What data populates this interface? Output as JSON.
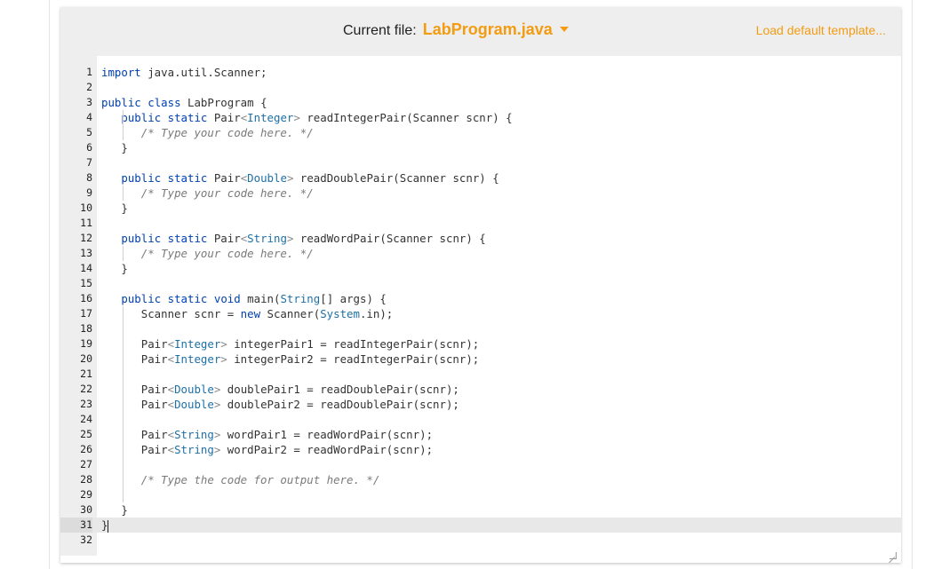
{
  "header": {
    "current_file_label": "Current file:",
    "current_file_name": "LabProgram.java",
    "load_default_label": "Load default template...",
    "accent_color": "#f39c12"
  },
  "editor": {
    "lines": [
      {
        "n": "1",
        "text": "import java.util.Scanner;"
      },
      {
        "n": "2",
        "text": ""
      },
      {
        "n": "3",
        "text": "public class LabProgram {"
      },
      {
        "n": "4",
        "text": "   public static Pair<Integer> readIntegerPair(Scanner scnr) {"
      },
      {
        "n": "5",
        "text": "      /* Type your code here. */"
      },
      {
        "n": "6",
        "text": "   }"
      },
      {
        "n": "7",
        "text": ""
      },
      {
        "n": "8",
        "text": "   public static Pair<Double> readDoublePair(Scanner scnr) {"
      },
      {
        "n": "9",
        "text": "      /* Type your code here. */"
      },
      {
        "n": "10",
        "text": "   }"
      },
      {
        "n": "11",
        "text": ""
      },
      {
        "n": "12",
        "text": "   public static Pair<String> readWordPair(Scanner scnr) {"
      },
      {
        "n": "13",
        "text": "      /* Type your code here. */"
      },
      {
        "n": "14",
        "text": "   }"
      },
      {
        "n": "15",
        "text": ""
      },
      {
        "n": "16",
        "text": "   public static void main(String[] args) {"
      },
      {
        "n": "17",
        "text": "      Scanner scnr = new Scanner(System.in);"
      },
      {
        "n": "18",
        "text": ""
      },
      {
        "n": "19",
        "text": "      Pair<Integer> integerPair1 = readIntegerPair(scnr);"
      },
      {
        "n": "20",
        "text": "      Pair<Integer> integerPair2 = readIntegerPair(scnr);"
      },
      {
        "n": "21",
        "text": ""
      },
      {
        "n": "22",
        "text": "      Pair<Double> doublePair1 = readDoublePair(scnr);"
      },
      {
        "n": "23",
        "text": "      Pair<Double> doublePair2 = readDoublePair(scnr);"
      },
      {
        "n": "24",
        "text": ""
      },
      {
        "n": "25",
        "text": "      Pair<String> wordPair1 = readWordPair(scnr);"
      },
      {
        "n": "26",
        "text": "      Pair<String> wordPair2 = readWordPair(scnr);"
      },
      {
        "n": "27",
        "text": ""
      },
      {
        "n": "28",
        "text": "      /* Type the code for output here. */"
      },
      {
        "n": "29",
        "text": ""
      },
      {
        "n": "30",
        "text": "   }"
      },
      {
        "n": "31",
        "text": "}"
      },
      {
        "n": "32",
        "text": ""
      }
    ],
    "active_line": "31"
  }
}
